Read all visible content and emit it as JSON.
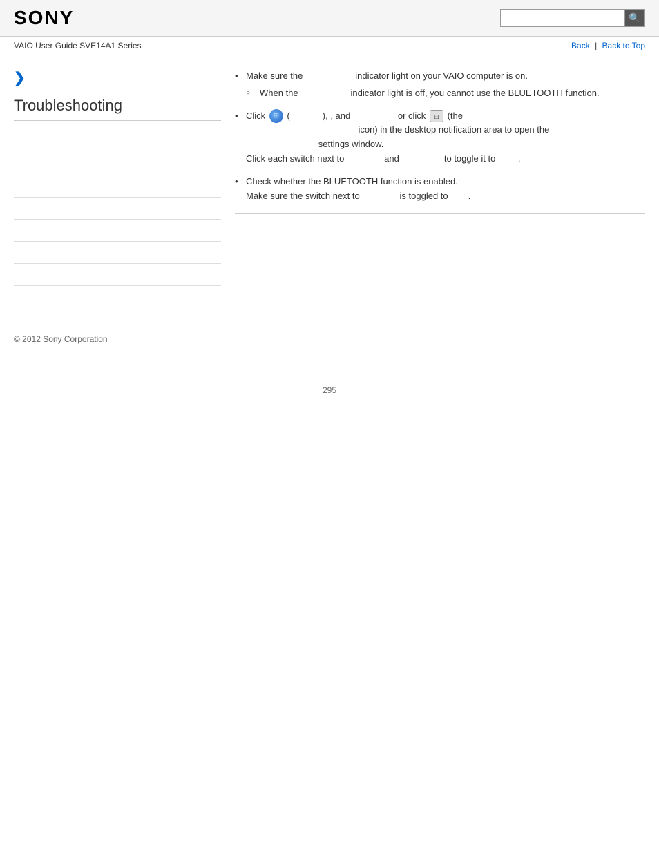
{
  "header": {
    "logo": "SONY",
    "search_placeholder": "",
    "search_icon": "🔍"
  },
  "nav": {
    "guide_title": "VAIO User Guide SVE14A1 Series",
    "back_label": "Back",
    "back_to_top_label": "Back to Top"
  },
  "sidebar": {
    "arrow": "❯",
    "title": "Troubleshooting",
    "links": [
      {
        "label": ""
      },
      {
        "label": ""
      },
      {
        "label": ""
      },
      {
        "label": ""
      },
      {
        "label": ""
      },
      {
        "label": ""
      },
      {
        "label": ""
      }
    ]
  },
  "content": {
    "bullet1": {
      "main": "Make sure the",
      "main2": "indicator light on your VAIO computer is on.",
      "sub": "When the",
      "sub2": "indicator light is off, you cannot use the BLUETOOTH function."
    },
    "bullet2": {
      "click": "Click",
      "paren_open": "(",
      "paren_close": "),",
      "and": ", and",
      "or_click": "or click",
      "the_label": "(the",
      "icon_label": "icon) in the desktop notification area to open the",
      "settings": "settings window.",
      "click_each": "Click each switch next to",
      "and2": "and",
      "toggle": "to toggle it to",
      "period": "."
    },
    "bullet3": {
      "main": "Check whether the BLUETOOTH function is enabled.",
      "make_sure": "Make sure the switch next to",
      "is_toggled": "is toggled to",
      "period": "."
    }
  },
  "footer": {
    "copyright": "© 2012 Sony Corporation"
  },
  "page_number": "295"
}
